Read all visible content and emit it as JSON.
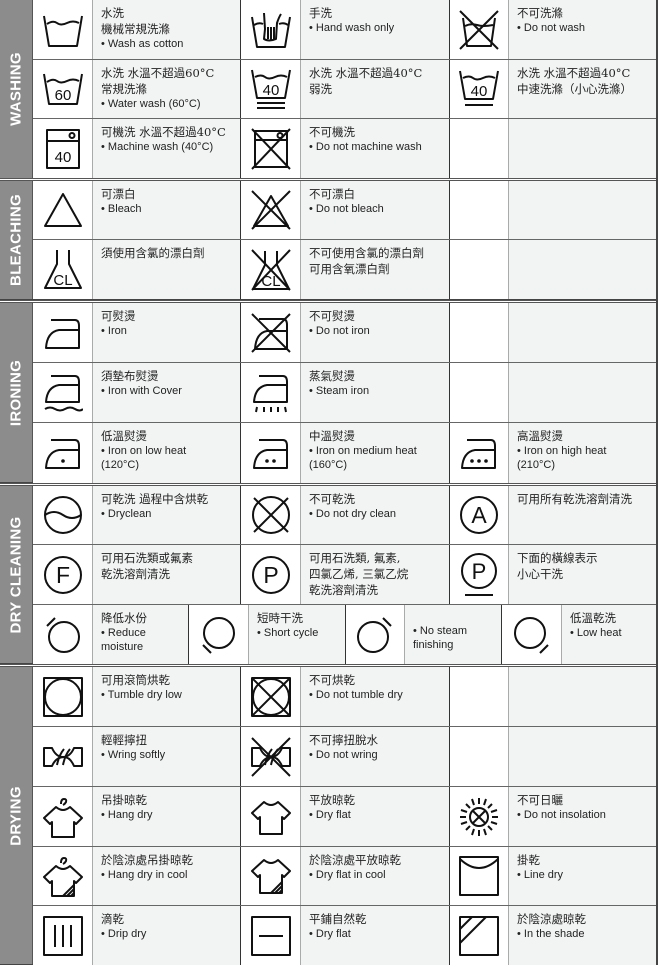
{
  "sections": [
    {
      "title": "WASHING",
      "rows": [
        [
          {
            "icon": "wash-tub-icon",
            "zh": "水洗\n機械常規洗滌",
            "en": "• Wash  as cotton"
          },
          {
            "icon": "hand-wash-icon",
            "zh": "手洗",
            "en": "• Hand wash only"
          },
          {
            "icon": "do-not-wash-icon",
            "zh": "不可洗滌",
            "en": "• Do not wash"
          }
        ],
        [
          {
            "icon": "wash-60-icon",
            "icon_label": "60",
            "zh": "水洗  水溫不超過60°C\n常規洗滌",
            "en": "• Water wash  (60°C)"
          },
          {
            "icon": "wash-40-very-gentle-icon",
            "icon_label": "40",
            "zh": "水洗  水溫不超過40°C\n弱洗",
            "en": ""
          },
          {
            "icon": "wash-40-gentle-icon",
            "icon_label": "40",
            "zh": "水洗  水溫不超過40°C\n中速洗滌（小心洗滌）",
            "en": ""
          }
        ],
        [
          {
            "icon": "machine-wash-40-icon",
            "icon_label": "40",
            "zh": "可機洗  水溫不超過40°C",
            "en": "• Machine wash  (40°C)"
          },
          {
            "icon": "do-not-machine-wash-icon",
            "zh": "不可機洗",
            "en": "• Do not machine wash"
          },
          {
            "icon": "",
            "zh": "",
            "en": ""
          }
        ]
      ]
    },
    {
      "title": "BLEACHING",
      "rows": [
        [
          {
            "icon": "bleach-triangle-icon",
            "zh": "可漂白",
            "en": "• Bleach"
          },
          {
            "icon": "do-not-bleach-icon",
            "zh": "不可漂白",
            "en": "• Do not bleach"
          },
          {
            "icon": "",
            "zh": "",
            "en": ""
          }
        ],
        [
          {
            "icon": "chlorine-bleach-icon",
            "icon_label": "CL",
            "zh": "須使用含氯的漂白劑",
            "en": ""
          },
          {
            "icon": "no-chlorine-bleach-icon",
            "icon_label": "CL",
            "zh": "不可使用含氯的漂白劑\n可用含氧漂白劑",
            "en": ""
          },
          {
            "icon": "",
            "zh": "",
            "en": ""
          }
        ]
      ]
    },
    {
      "title": "IRONING",
      "rows": [
        [
          {
            "icon": "iron-icon",
            "zh": "可熨燙",
            "en": "• Iron"
          },
          {
            "icon": "do-not-iron-icon",
            "zh": "不可熨燙",
            "en": "• Do not iron"
          },
          {
            "icon": "",
            "zh": "",
            "en": ""
          }
        ],
        [
          {
            "icon": "iron-with-cover-icon",
            "zh": "須墊布熨燙",
            "en": "• Iron with Cover"
          },
          {
            "icon": "steam-iron-icon",
            "zh": "蒸氣熨燙",
            "en": "• Steam iron"
          },
          {
            "icon": "",
            "zh": "",
            "en": ""
          }
        ],
        [
          {
            "icon": "iron-low-heat-icon",
            "dots": 1,
            "zh": "低溫熨燙",
            "en": "• Iron on low heat\n  (120°C)"
          },
          {
            "icon": "iron-medium-heat-icon",
            "dots": 2,
            "zh": "中溫熨燙",
            "en": "• Iron on medium heat\n  (160°C)"
          },
          {
            "icon": "iron-high-heat-icon",
            "dots": 3,
            "zh": "高溫熨燙",
            "en": "• Iron on high heat\n  (210°C)"
          }
        ]
      ]
    },
    {
      "title": "DRY CLEANING",
      "rows": [
        [
          {
            "icon": "dryclean-circle-icon",
            "zh": "可乾洗  過程中含烘乾",
            "en": "• Dryclean"
          },
          {
            "icon": "do-not-dryclean-icon",
            "zh": "不可乾洗",
            "en": "• Do not dry clean"
          },
          {
            "icon": "dryclean-a-icon",
            "icon_label": "A",
            "zh": "可用所有乾洗溶劑清洗",
            "en": ""
          }
        ],
        [
          {
            "icon": "dryclean-f-icon",
            "icon_label": "F",
            "zh": "可用石洗類或氟素\n乾洗溶劑清洗",
            "en": ""
          },
          {
            "icon": "dryclean-p-icon",
            "icon_label": "P",
            "zh": "可用石洗類, 氟素,\n四氯乙烯, 三氯乙烷\n乾洗溶劑清洗",
            "en": ""
          },
          {
            "icon": "dryclean-p-gentle-icon",
            "icon_label": "P",
            "zh": "下面的橫線表示\n小心干洗",
            "en": ""
          }
        ],
        [
          {
            "icon": "reduce-moisture-icon",
            "zh": "降低水份",
            "en": "• Reduce\n  moisture"
          },
          {
            "icon": "short-cycle-icon",
            "zh": "短時干洗",
            "en": "• Short cycle"
          },
          {
            "icon": "no-steam-finishing-icon",
            "zh": "",
            "en": "• No steam\n  finishing"
          },
          {
            "icon": "low-heat-dryclean-icon",
            "zh": "低溫乾洗",
            "en": "• Low heat"
          }
        ]
      ]
    },
    {
      "title": "DRYING",
      "rows": [
        [
          {
            "icon": "tumble-dry-icon",
            "zh": "可用滾筒烘乾",
            "en": "• Tumble dry low"
          },
          {
            "icon": "do-not-tumble-dry-icon",
            "zh": "不可烘乾",
            "en": "• Do not tumble dry"
          },
          {
            "icon": "",
            "zh": "",
            "en": ""
          }
        ],
        [
          {
            "icon": "wring-icon",
            "zh": "輕輕擰扭",
            "en": "• Wring softly"
          },
          {
            "icon": "do-not-wring-icon",
            "zh": "不可擰扭脫水",
            "en": "• Do not wring"
          },
          {
            "icon": "",
            "zh": "",
            "en": ""
          }
        ],
        [
          {
            "icon": "hang-dry-icon",
            "zh": "吊掛晾乾",
            "en": "• Hang dry"
          },
          {
            "icon": "dry-flat-shirt-icon",
            "zh": "平放晾乾",
            "en": "• Dry flat"
          },
          {
            "icon": "do-not-sun-dry-icon",
            "zh": "不可日曬",
            "en": "• Do not insolation"
          }
        ],
        [
          {
            "icon": "hang-dry-shade-icon",
            "zh": "於陰涼處吊掛晾乾",
            "en": "•  Hang dry in cool"
          },
          {
            "icon": "dry-flat-shade-icon",
            "zh": "於陰涼處平放晾乾",
            "en": "• Dry flat in cool"
          },
          {
            "icon": "line-dry-icon",
            "zh": "掛乾",
            "en": "• Line dry"
          }
        ],
        [
          {
            "icon": "drip-dry-icon",
            "zh": "滴乾",
            "en": "• Drip dry"
          },
          {
            "icon": "dry-flat-square-icon",
            "zh": "平鋪自然乾",
            "en": "• Dry flat"
          },
          {
            "icon": "dry-in-shade-icon",
            "zh": "於陰涼處晾乾",
            "en": "• In the shade"
          }
        ]
      ]
    }
  ]
}
